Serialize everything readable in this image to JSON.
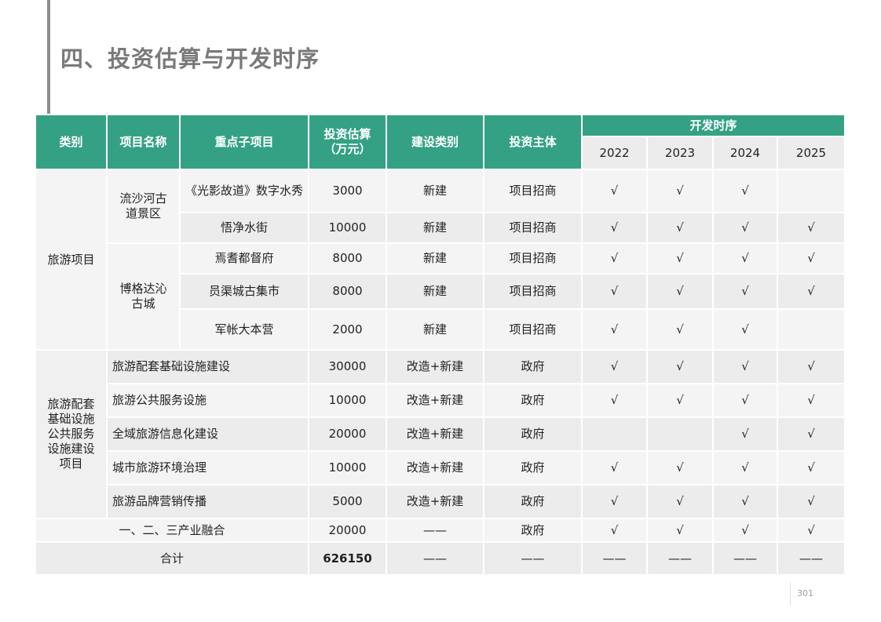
{
  "page": {
    "title": "四、投资估算与开发时序",
    "page_number": "301"
  },
  "header": {
    "category": "类别",
    "project_name": "项目名称",
    "key_subproject": "重点子项目",
    "investment": "投资估算",
    "investment_unit": "（万元）",
    "build_type": "建设类别",
    "investor": "投资主体",
    "schedule": "开发时序",
    "years": [
      "2022",
      "2023",
      "2024",
      "2025"
    ]
  },
  "groups": {
    "tourism": "旅游项目",
    "support": "旅游配套基础设施公共服务设施建设项目",
    "liusha": "流沙河古道景区",
    "boge": "博格达沁古城"
  },
  "rows": [
    {
      "sub": "《光影故道》数字水秀",
      "amount": "3000",
      "type": "新建",
      "investor": "项目招商",
      "y": [
        "√",
        "√",
        "√",
        ""
      ]
    },
    {
      "sub": "悟净水街",
      "amount": "10000",
      "type": "新建",
      "investor": "项目招商",
      "y": [
        "√",
        "√",
        "√",
        "√"
      ]
    },
    {
      "sub": "焉耆都督府",
      "amount": "8000",
      "type": "新建",
      "investor": "项目招商",
      "y": [
        "√",
        "√",
        "√",
        "√"
      ]
    },
    {
      "sub": "员渠城古集市",
      "amount": "8000",
      "type": "新建",
      "investor": "项目招商",
      "y": [
        "√",
        "√",
        "√",
        "√"
      ]
    },
    {
      "sub": "军帐大本营",
      "amount": "2000",
      "type": "新建",
      "investor": "项目招商",
      "y": [
        "√",
        "√",
        "√",
        ""
      ]
    },
    {
      "name": "旅游配套基础设施建设",
      "amount": "30000",
      "type": "改造+新建",
      "investor": "政府",
      "y": [
        "√",
        "√",
        "√",
        "√"
      ]
    },
    {
      "name": "旅游公共服务设施",
      "amount": "10000",
      "type": "改造+新建",
      "investor": "政府",
      "y": [
        "√",
        "√",
        "√",
        "√"
      ]
    },
    {
      "name": "全域旅游信息化建设",
      "amount": "20000",
      "type": "改造+新建",
      "investor": "政府",
      "y": [
        "",
        "",
        "√",
        "√"
      ]
    },
    {
      "name": "城市旅游环境治理",
      "amount": "10000",
      "type": "改造+新建",
      "investor": "政府",
      "y": [
        "√",
        "√",
        "√",
        "√"
      ]
    },
    {
      "name": "旅游品牌营销传播",
      "amount": "5000",
      "type": "改造+新建",
      "investor": "政府",
      "y": [
        "√",
        "√",
        "√",
        "√"
      ]
    },
    {
      "name": "一、二、三产业融合",
      "amount": "20000",
      "type": "——",
      "investor": "政府",
      "y": [
        "√",
        "√",
        "√",
        "√"
      ]
    }
  ],
  "total": {
    "label": "合计",
    "amount": "626150",
    "type": "——",
    "investor": "——",
    "y": [
      "——",
      "——",
      "——",
      "——"
    ]
  }
}
